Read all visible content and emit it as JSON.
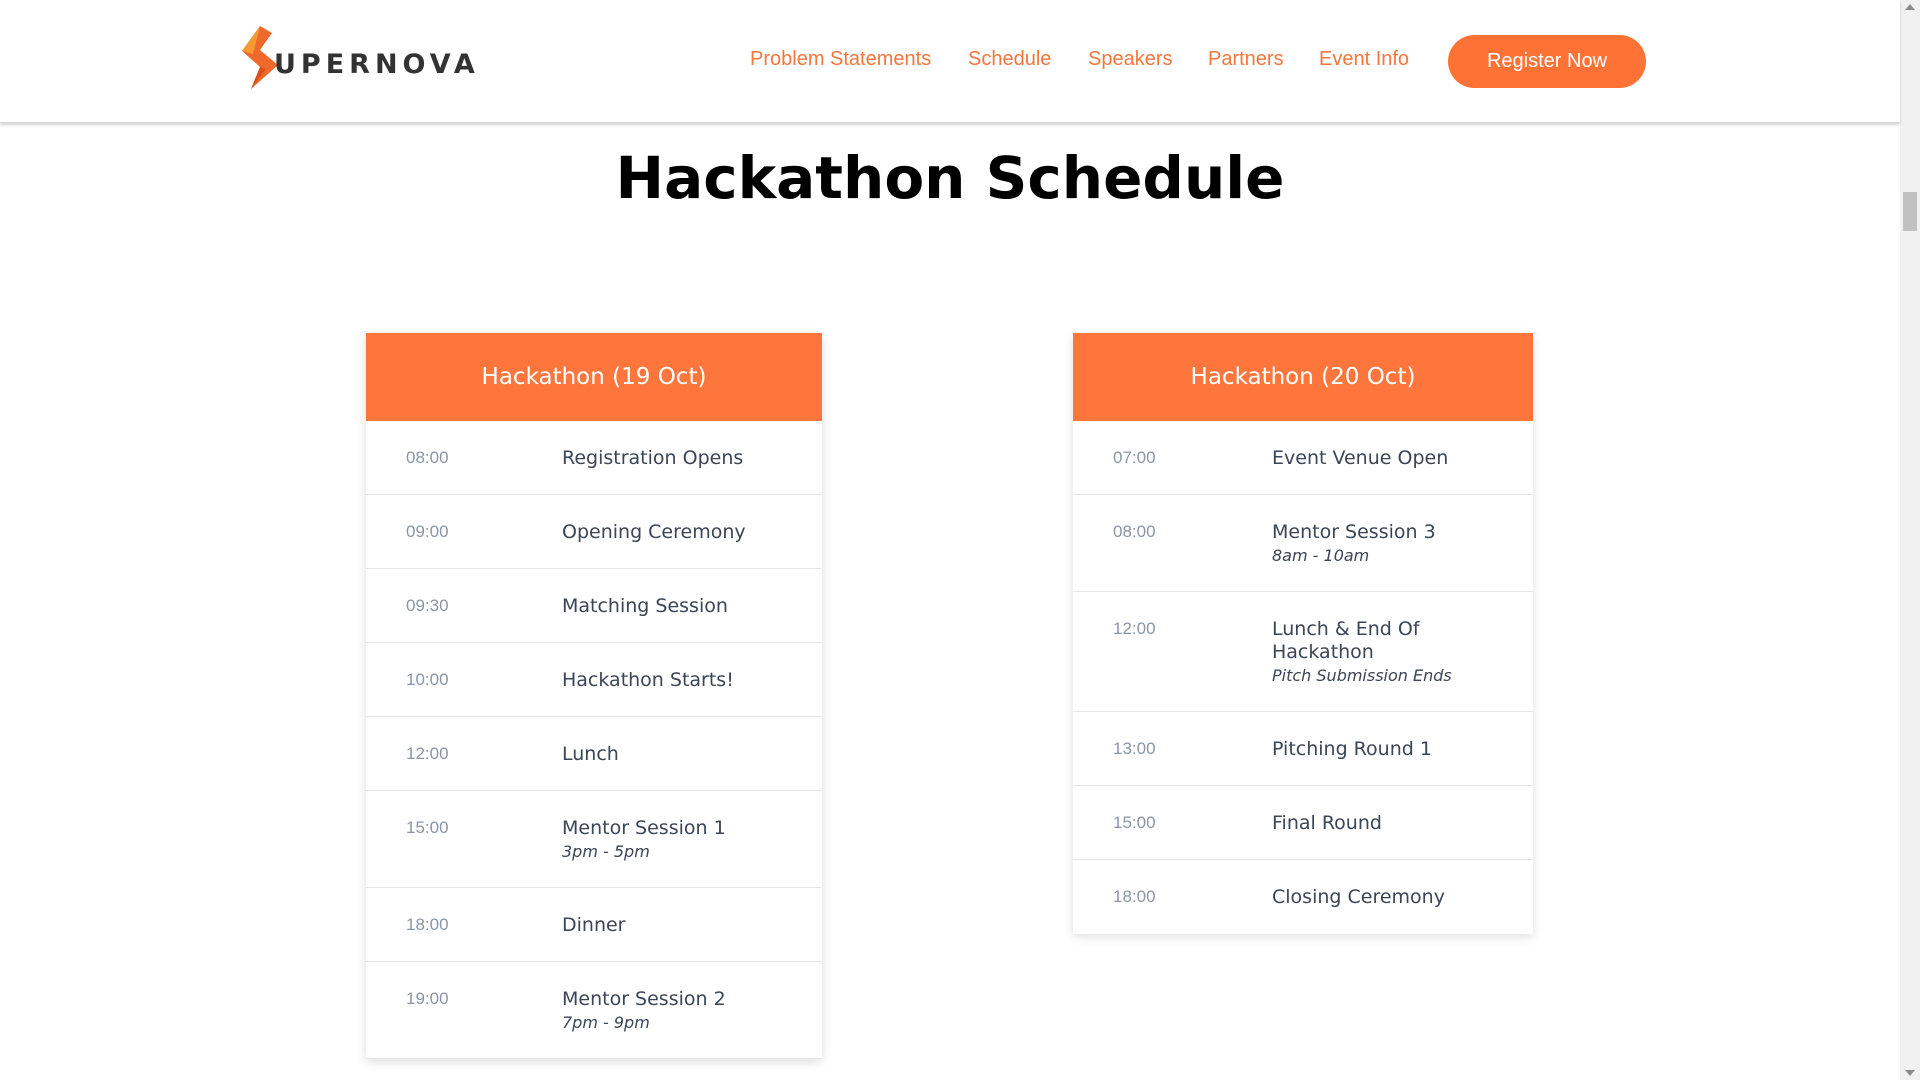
{
  "brand": {
    "logo_text": "UPERNOVA",
    "accent": "#ff763c",
    "nav_color": "#f5763c"
  },
  "nav": {
    "items": [
      {
        "label": "Problem Statements"
      },
      {
        "label": "Schedule"
      },
      {
        "label": "Speakers"
      },
      {
        "label": "Partners"
      },
      {
        "label": "Event Info"
      }
    ],
    "register_label": "Register Now"
  },
  "page": {
    "title": "Hackathon Schedule"
  },
  "schedules": [
    {
      "title": "Hackathon (19 Oct)",
      "rows": [
        {
          "time": "08:00",
          "event": "Registration Opens",
          "sub": ""
        },
        {
          "time": "09:00",
          "event": "Opening Ceremony",
          "sub": ""
        },
        {
          "time": "09:30",
          "event": "Matching Session",
          "sub": ""
        },
        {
          "time": "10:00",
          "event": "Hackathon Starts!",
          "sub": ""
        },
        {
          "time": "12:00",
          "event": "Lunch",
          "sub": ""
        },
        {
          "time": "15:00",
          "event": "Mentor Session 1",
          "sub": "3pm - 5pm"
        },
        {
          "time": "18:00",
          "event": "Dinner",
          "sub": ""
        },
        {
          "time": "19:00",
          "event": "Mentor Session 2",
          "sub": "7pm - 9pm"
        }
      ]
    },
    {
      "title": "Hackathon (20 Oct)",
      "rows": [
        {
          "time": "07:00",
          "event": "Event Venue Open",
          "sub": ""
        },
        {
          "time": "08:00",
          "event": "Mentor Session 3",
          "sub": "8am - 10am"
        },
        {
          "time": "12:00",
          "event": "Lunch & End Of Hackathon",
          "sub": "Pitch Submission Ends"
        },
        {
          "time": "13:00",
          "event": "Pitching Round 1",
          "sub": ""
        },
        {
          "time": "15:00",
          "event": "Final Round",
          "sub": ""
        },
        {
          "time": "18:00",
          "event": "Closing Ceremony",
          "sub": ""
        }
      ]
    }
  ]
}
